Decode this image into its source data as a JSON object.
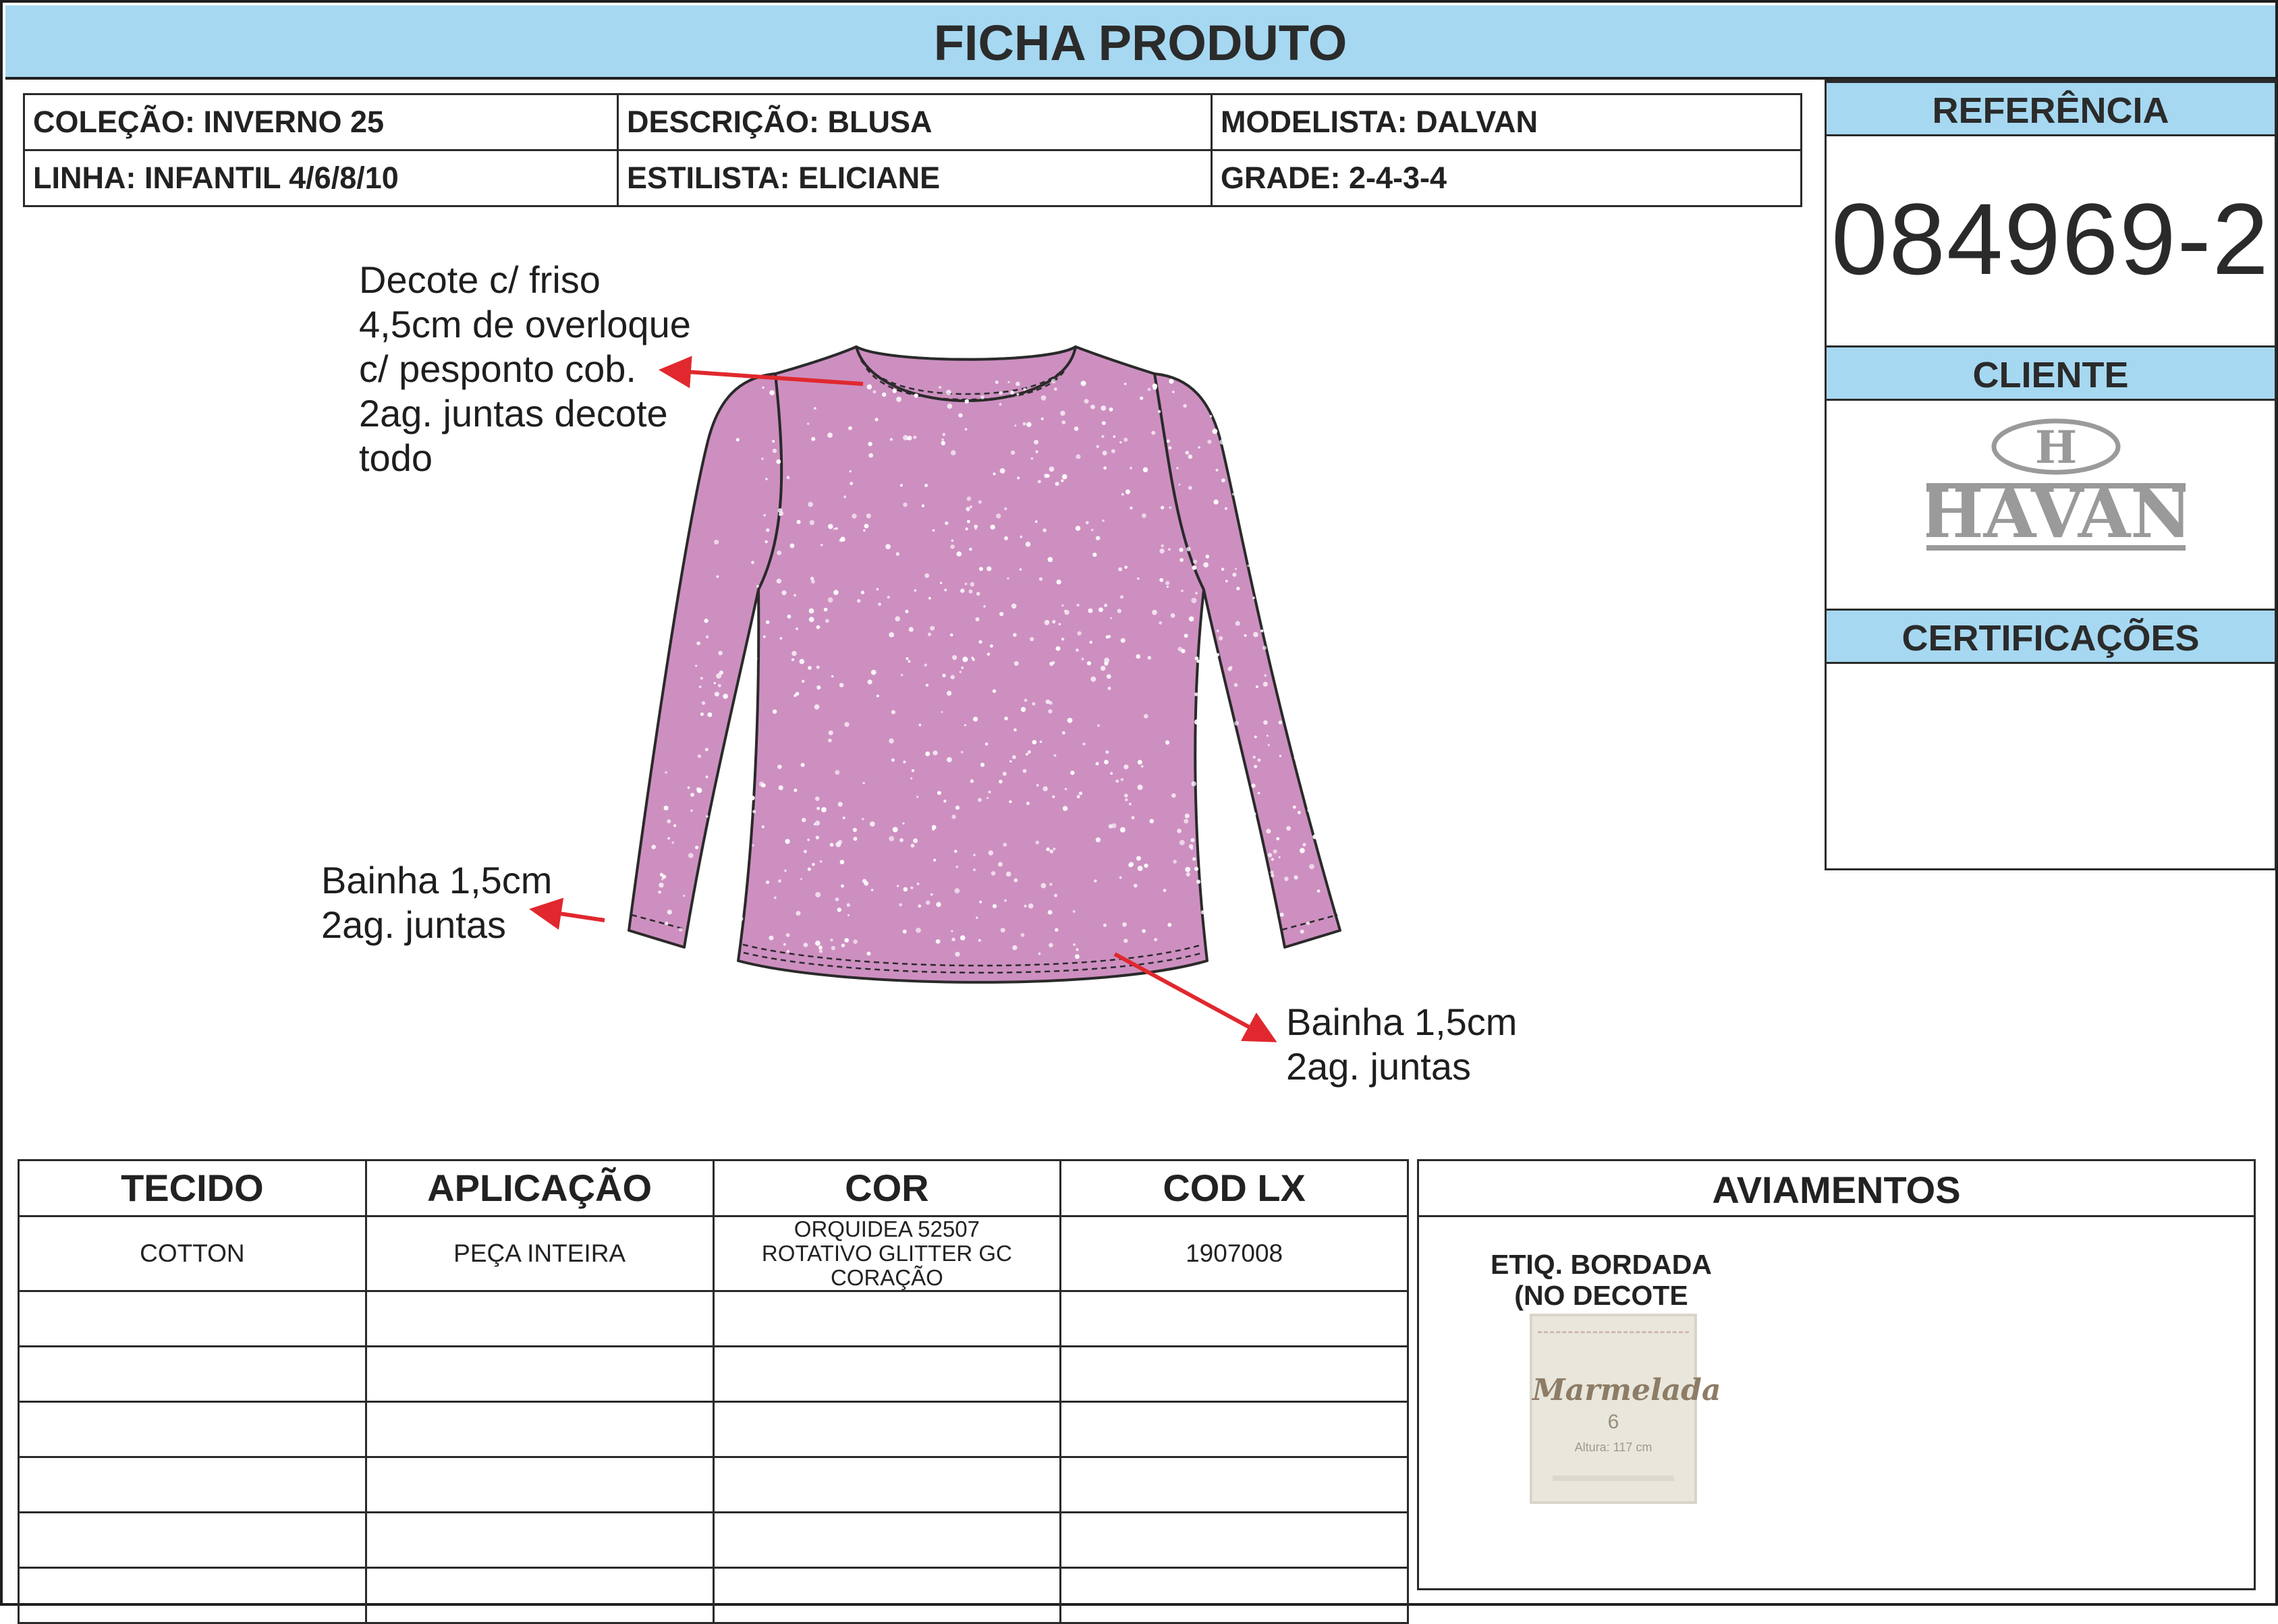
{
  "title": "FICHA PRODUTO",
  "info": {
    "colecao": "COLEÇÃO: INVERNO 25",
    "descricao": "DESCRIÇÃO: BLUSA",
    "modelista": "MODELISTA: DALVAN",
    "linha": "LINHA: INFANTIL 4/6/8/10",
    "estilista": "ESTILISTA: ELICIANE",
    "grade": "GRADE: 2-4-3-4"
  },
  "panel": {
    "referencia_label": "REFERÊNCIA",
    "referencia_value": "084969-2",
    "cliente_label": "CLIENTE",
    "cliente_logo_letter": "H",
    "cliente_logo_text": "HAVAN",
    "certificacoes_label": "CERTIFICAÇÕES"
  },
  "annotations": {
    "decote": [
      "Decote c/ friso",
      "4,5cm de overloque",
      "c/ pesponto cob.",
      "2ag. juntas decote",
      "todo"
    ],
    "bainha_manga": [
      "Bainha 1,5cm",
      "2ag. juntas"
    ],
    "bainha_barra": [
      "Bainha 1,5cm",
      "2ag. juntas"
    ]
  },
  "garment": {
    "color": "#cd8fc0",
    "outline_color": "#2a2a2a",
    "glitter_color": "#ffffff"
  },
  "fabric_table": {
    "headers": [
      "TECIDO",
      "APLICAÇÃO",
      "COR",
      "COD LX"
    ],
    "rows": [
      [
        "COTTON",
        "PEÇA INTEIRA",
        "ORQUIDEA 52507 ROTATIVO GLITTER GC CORAÇÃO",
        "1907008"
      ],
      [
        "",
        "",
        "",
        ""
      ],
      [
        "",
        "",
        "",
        ""
      ],
      [
        "",
        "",
        "",
        ""
      ],
      [
        "",
        "",
        "",
        ""
      ],
      [
        "",
        "",
        "",
        ""
      ],
      [
        "",
        "",
        "",
        ""
      ]
    ]
  },
  "aviamentos": {
    "title": "AVIAMENTOS",
    "item_label_line1": "ETIQ. BORDADA",
    "item_label_line2": "(NO DECOTE COSTAS)",
    "label_brand": "Marmelada",
    "label_size": "6",
    "label_height": "Altura: 117 cm"
  },
  "colors": {
    "header_blue": "#a6d8f1",
    "arrow_red": "#e0282e",
    "logo_gray": "#9a9a9a"
  }
}
